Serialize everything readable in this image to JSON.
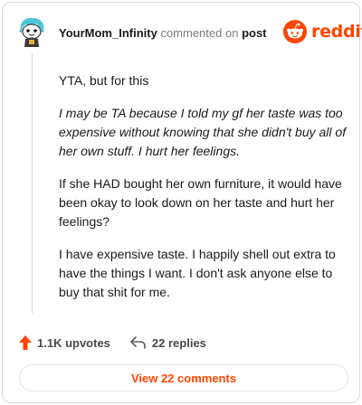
{
  "header": {
    "username": "YourMom_Infinity",
    "action": "commented on",
    "target": "post",
    "brand": "reddit"
  },
  "comment": {
    "paragraphs": [
      {
        "text": "YTA, but for this",
        "style": "normal"
      },
      {
        "text": "I may be TA because I told my gf her taste was too expensive without knowing that she didn't buy all of her own stuff. I hurt her feelings.",
        "style": "italic"
      },
      {
        "text": "If she HAD bought her own furniture, it would have been okay to look down on her taste and hurt her feelings?",
        "style": "normal"
      },
      {
        "text": "I have expensive taste. I happily shell out extra to have the things I want. I don't ask anyone else to buy that shit for me.",
        "style": "normal"
      }
    ]
  },
  "footer": {
    "upvotes": "1.1K upvotes",
    "replies": "22 replies",
    "view_comments": "View 22 comments"
  },
  "colors": {
    "accent": "#ff4500",
    "avatar_hair": "#4fc6d8"
  },
  "icons": {
    "avatar": "snoo-avatar-icon",
    "brand": "reddit-snoo-icon",
    "upvote": "upvote-arrow-icon",
    "reply": "reply-arrow-icon"
  }
}
